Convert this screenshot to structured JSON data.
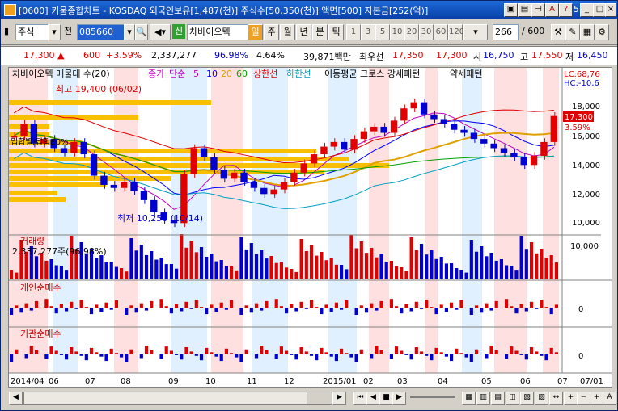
{
  "window": {
    "title": "[0600] 키움종합차트 - KOSDAQ 외국인보유[1,487(천)] 주식수[50,350(천)] 액면[500] 자본금[252(억)]",
    "counter": "5"
  },
  "toolbar": {
    "type_select": "주식",
    "prev_label": "전",
    "code": "085660",
    "badge": "신",
    "stock_name": "차바이오텍",
    "periods": [
      "일",
      "주",
      "월",
      "년",
      "분",
      "틱"
    ],
    "active_period": "일",
    "minutes": [
      "1",
      "3",
      "5",
      "10",
      "20",
      "30",
      "60",
      "120"
    ],
    "count": "266",
    "total": "/ 600"
  },
  "quote": {
    "price": "17,300",
    "change": "600",
    "rate": "+3.59%",
    "volume": "2,337,277",
    "vol_ratio": "96.98%",
    "turnover": "4.64%",
    "amount": "39,871백만",
    "prio_label": "최우선",
    "bid": "17,350",
    "ask": "17,300",
    "open_label": "시",
    "open": "16,750",
    "high_label": "고",
    "high": "17,550",
    "low_label": "저",
    "low": "16,450"
  },
  "chart": {
    "legend": {
      "name": "차바이오텍 매물대 수(20)",
      "close_label": "종가",
      "ma_label": "단순",
      "ma5": "5",
      "ma10": "10",
      "ma20": "20",
      "ma60": "60",
      "upper": "상한선",
      "lower": "하한선",
      "pattern": "이동평균 크로스 강세패턴",
      "weak": "약세패턴"
    },
    "lc": "LC:68,76",
    "hc": "HC:-10,6",
    "high_note": "최고 19,400 (06/02)",
    "low_note": "최저 10,250 (10/14)",
    "ichimoku_note": "입합별/답합80%",
    "price_label": "17,300",
    "price_pct": "3.59%",
    "y_ticks": [
      "18,000",
      "16,000",
      "14,000",
      "12,000",
      "10,000"
    ],
    "volume_title": "거래량",
    "volume_value": "2,337,277주(96,98%)",
    "volume_tick": "10,000",
    "indiv_title": "개인순매수",
    "inst_title": "기관순매수",
    "zero": "0",
    "x_labels": [
      "2014/04",
      "06",
      "07",
      "08",
      "09",
      "10",
      "11",
      "12",
      "2015/01",
      "02",
      "03",
      "04",
      "05",
      "06",
      "07",
      "07/01"
    ]
  },
  "chart_data": {
    "type": "candlestick",
    "title": "차바이오텍",
    "y_range": [
      10000,
      19500
    ],
    "close_series": [
      16000,
      16800,
      15500,
      15800,
      15200,
      14900,
      15600,
      14800,
      13400,
      12800,
      12600,
      13000,
      12400,
      11800,
      11000,
      10500,
      10300,
      13500,
      15200,
      14600,
      13800,
      13200,
      13600,
      13000,
      12600,
      12200,
      12500,
      13000,
      13600,
      14200,
      14800,
      15300,
      15600,
      15100,
      15800,
      16300,
      16600,
      16200,
      17000,
      17800,
      18200,
      17400,
      17100,
      16800,
      16400,
      16200,
      15800,
      15500,
      15200,
      14900,
      14600,
      14100,
      14700,
      15600,
      17300
    ]
  }
}
